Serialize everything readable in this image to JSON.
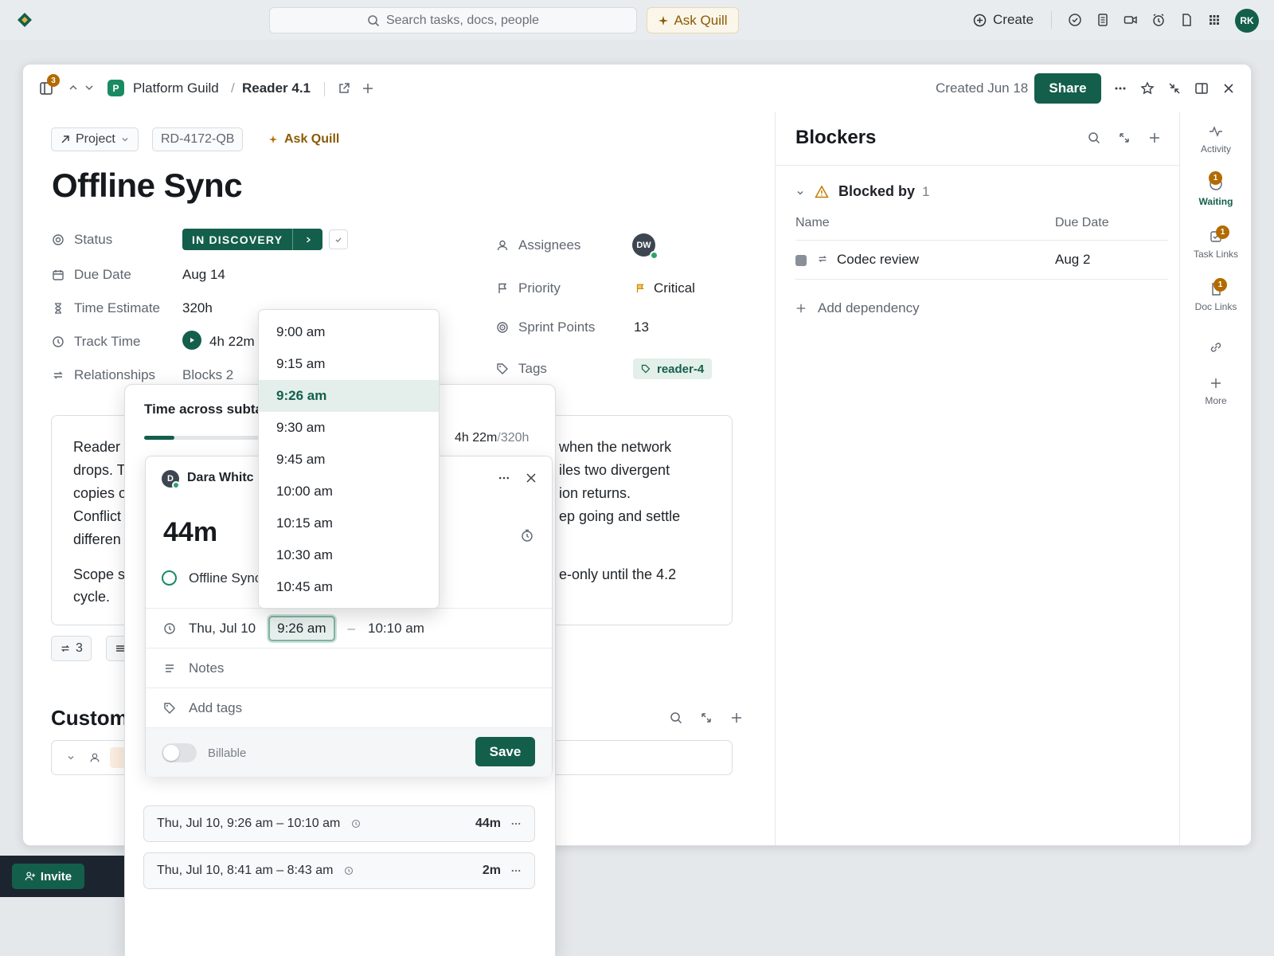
{
  "topbar": {
    "search_placeholder": "Search tasks, docs, people",
    "ask_quill": "Ask Quill",
    "create": "Create",
    "avatar": "RK"
  },
  "header": {
    "notif_count": "3",
    "space_initial": "P",
    "space": "Platform Guild",
    "separator": "/",
    "list": "Reader 4.1",
    "created": "Created Jun 18",
    "share": "Share"
  },
  "task": {
    "type": "Project",
    "id": "RD-4172-QB",
    "ask_quill": "Ask Quill",
    "title": "Offline Sync"
  },
  "fields": {
    "status_label": "Status",
    "status_value": "IN DISCOVERY",
    "due_label": "Due Date",
    "due_value": "Aug 14",
    "estimate_label": "Time Estimate",
    "estimate_value": "320h",
    "track_label": "Track Time",
    "track_value": "4h 22m",
    "relationships_label": "Relationships",
    "relationships_value": "Blocks 2",
    "assignees_label": "Assignees",
    "assignee_initials": "DW",
    "priority_label": "Priority",
    "priority_value": "Critical",
    "sprint_label": "Sprint Points",
    "sprint_value": "13",
    "tags_label": "Tags",
    "tag_value": "reader-4"
  },
  "description": {
    "left": [
      "Reader",
      "drops. T",
      "copies o",
      "Conflict",
      "differen",
      "Scope s",
      "cycle."
    ],
    "right": [
      "when the network",
      "iles two divergent",
      "ion returns.",
      "ep going and settle",
      "e-only until the 4.2"
    ]
  },
  "below_desc": {
    "subtask_count": "3",
    "custom_heading": "Custom"
  },
  "blockers": {
    "title": "Blockers",
    "group": "Blocked by",
    "group_count": "1",
    "col_name": "Name",
    "col_due": "Due Date",
    "rows": [
      {
        "name": "Codec review",
        "due": "Aug 2"
      }
    ],
    "add": "Add dependency"
  },
  "rail": {
    "activity": "Activity",
    "waiting": "Waiting",
    "waiting_badge": "1",
    "task_links": "Task Links",
    "task_links_badge": "1",
    "doc_links": "Doc Links",
    "doc_links_badge": "1",
    "more": "More"
  },
  "time_panel": {
    "title": "Time across subta",
    "tracked": "4h 22m",
    "slash": "/",
    "total": "320h",
    "progress_fraction": 0.23
  },
  "entry": {
    "user_initial": "D",
    "user": "Dara Whitc",
    "duration": "44m",
    "task": "Offline Sync",
    "date": "Thu, Jul 10",
    "start": "9:26 am",
    "dash": "–",
    "end": "10:10 am",
    "notes": "Notes",
    "tags": "Add tags",
    "billable": "Billable",
    "save": "Save"
  },
  "time_options": [
    "9:00 am",
    "9:15 am",
    "9:26 am",
    "9:30 am",
    "9:45 am",
    "10:00 am",
    "10:15 am",
    "10:30 am",
    "10:45 am"
  ],
  "time_selected_index": 2,
  "logs": [
    {
      "range": "Thu, Jul 10, 9:26 am – 10:10 am",
      "duration": "44m"
    },
    {
      "range": "Thu, Jul 10, 8:41 am – 8:43 am",
      "duration": "2m"
    }
  ],
  "invite": "Invite",
  "colors": {
    "brand": "#135f4b",
    "accent_gold": "#b36b00",
    "priority": "#d08a00"
  }
}
